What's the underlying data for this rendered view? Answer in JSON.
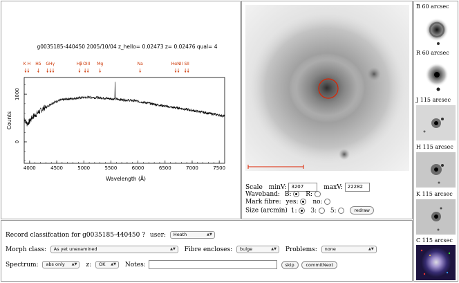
{
  "spectrum": {
    "title": "g0035185-440450  2005/10/04  z_hello= 0.02473  z= 0.02476  qual= 4",
    "ylabel": "Counts",
    "xlabel": "Wavelength (Å)",
    "line_color": "#cc3300",
    "lines": [
      {
        "label": "K H",
        "x": 3950,
        "marks": 2
      },
      {
        "label": "Hδ",
        "x": 4160,
        "marks": 1
      },
      {
        "label": "G",
        "x": 4330,
        "marks": 1
      },
      {
        "label": "Hγ",
        "x": 4410,
        "marks": 2
      },
      {
        "label": "Hβ",
        "x": 4920,
        "marks": 1
      },
      {
        "label": "OIII",
        "x": 5050,
        "marks": 2
      },
      {
        "label": "Mg",
        "x": 5300,
        "marks": 1
      },
      {
        "label": "Na",
        "x": 6040,
        "marks": 1
      },
      {
        "label": "HαNII",
        "x": 6720,
        "marks": 2
      },
      {
        "label": "SII",
        "x": 6900,
        "marks": 2
      }
    ]
  },
  "chart_data": {
    "type": "line",
    "title": "g0035185-440450  2005/10/04  z_hello= 0.02473  z= 0.02476  qual= 4",
    "xlabel": "Wavelength (Å)",
    "ylabel": "Counts",
    "xlim": [
      3900,
      7600
    ],
    "ylim": [
      -450,
      1350
    ],
    "xticks": [
      "4000",
      "4500",
      "5000",
      "5500",
      "6000",
      "6500",
      "7000",
      "7500"
    ],
    "yticks": [
      "0",
      "1000"
    ],
    "series": [
      {
        "x": [
          3900,
          3950,
          4000,
          4050,
          4100,
          4150,
          4200,
          4250,
          4300,
          4350,
          4400,
          4450,
          4500,
          4550,
          4600,
          4650,
          4700,
          4750,
          4800,
          4850,
          4900,
          4950,
          5000,
          5050,
          5100,
          5150,
          5200,
          5250,
          5300,
          5350,
          5400,
          5450,
          5500,
          5550,
          5600,
          5650,
          5700,
          5750,
          5800,
          5850,
          5900,
          5950,
          6000,
          6050,
          6100,
          6150,
          6200,
          6250,
          6300,
          6350,
          6400,
          6450,
          6500,
          6550,
          6600,
          6650,
          6700,
          6750,
          6800,
          6850,
          6900,
          6950,
          7000,
          7050,
          7100,
          7150,
          7200,
          7250,
          7300,
          7350,
          7400,
          7450,
          7500,
          7550,
          7600
        ],
        "values": [
          500,
          380,
          430,
          520,
          560,
          610,
          650,
          700,
          720,
          760,
          800,
          830,
          850,
          870,
          880,
          890,
          900,
          905,
          910,
          915,
          920,
          925,
          930,
          932,
          935,
          932,
          930,
          928,
          925,
          920,
          915,
          910,
          905,
          900,
          895,
          890,
          885,
          880,
          875,
          870,
          865,
          860,
          850,
          840,
          830,
          820,
          810,
          800,
          790,
          780,
          770,
          760,
          750,
          740,
          730,
          720,
          715,
          710,
          700,
          690,
          680,
          670,
          660,
          650,
          640,
          630,
          620,
          610,
          600,
          590,
          580,
          570,
          560,
          550,
          540
        ]
      }
    ],
    "spike": {
      "x": 5577,
      "y": 1260
    }
  },
  "image_panel": {
    "scale_label": "Scale",
    "minv_label": "minV:",
    "minv": "3207",
    "maxv_label": "maxV:",
    "maxv": "22282",
    "waveband_label": "Waveband:",
    "waveband_b": "B:",
    "waveband_r": "R:",
    "mark_fibre_label": "Mark fibre:",
    "mark_yes": "yes:",
    "mark_no": "no:",
    "size_label": "Size (arcmin)",
    "size_1": "1:",
    "size_3": "3:",
    "size_5": "5:",
    "redraw": "redraw",
    "fibre_color": "#dd2200"
  },
  "thumbnails": [
    {
      "label": "B 60 arcsec"
    },
    {
      "label": "R 60 arcsec"
    },
    {
      "label": "J 115 arcsec"
    },
    {
      "label": "H 115 arcsec"
    },
    {
      "label": "K 115 arcsec"
    },
    {
      "label": "C 115 arcsec"
    }
  ],
  "form": {
    "record_label": "Record classifcation for g0035185-440450 ?",
    "user_label": "user:",
    "user_value": "Heath",
    "morph_label": "Morph class:",
    "morph_value": "As yet unexamined",
    "fibre_label": "Fibre encloses:",
    "fibre_value": "bulge",
    "problems_label": "Problems:",
    "problems_value": "none",
    "spectrum_label": "Spectrum:",
    "spectrum_value": "abs only",
    "z_label": "z:",
    "z_value": "OK",
    "notes_label": "Notes:",
    "notes_value": "",
    "skip": "skip",
    "commit": "commitNext"
  }
}
